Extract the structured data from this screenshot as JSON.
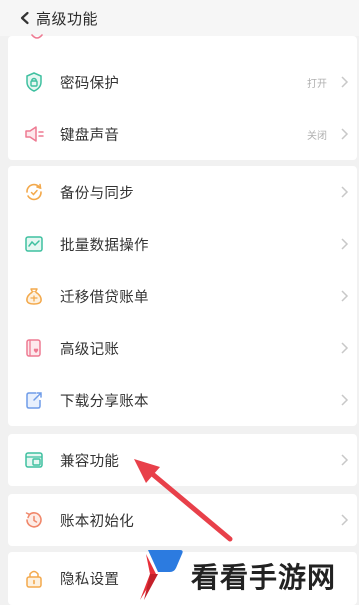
{
  "header": {
    "title": "高级功能"
  },
  "section1": {
    "items": [
      {
        "label": "密码保护",
        "value": "打开"
      },
      {
        "label": "键盘声音",
        "value": "关闭"
      }
    ]
  },
  "section2": {
    "items": [
      {
        "label": "备份与同步"
      },
      {
        "label": "批量数据操作"
      },
      {
        "label": "迁移借贷账单"
      },
      {
        "label": "高级记账"
      },
      {
        "label": "下载分享账本"
      }
    ]
  },
  "section3": {
    "items": [
      {
        "label": "兼容功能"
      }
    ]
  },
  "section4": {
    "items": [
      {
        "label": "账本初始化"
      }
    ]
  },
  "section5": {
    "items": [
      {
        "label": "隐私设置"
      }
    ]
  },
  "watermark": {
    "text": "看看手游网"
  },
  "colors": {
    "green": "#3fc0a0",
    "pink": "#ee7a92",
    "orange": "#f3a94c",
    "blue": "#6f9ce8",
    "arrow_red": "#e8404a",
    "logo_blue": "#2c7be0",
    "logo_red": "#e8303a"
  }
}
